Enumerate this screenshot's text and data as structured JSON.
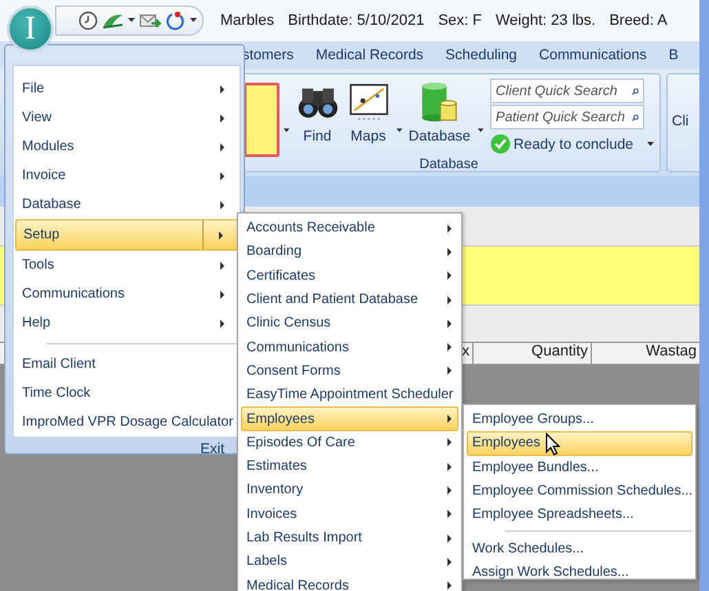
{
  "app_button": {
    "label": "I"
  },
  "patient_info": [
    "Marbles",
    "Birthdate: 5/10/2021",
    "Sex: F",
    "Weight: 23 lbs.",
    "Breed: A"
  ],
  "ribbon_tabs": [
    {
      "label": "stomers",
      "selected": false
    },
    {
      "label": "Medical Records",
      "selected": false
    },
    {
      "label": "Scheduling",
      "selected": false
    },
    {
      "label": "Communications",
      "selected": false
    },
    {
      "label": "B",
      "selected": false
    }
  ],
  "ribbon": {
    "buttons": [
      {
        "label": "Find",
        "kind": "binoculars"
      },
      {
        "label": "Maps",
        "kind": "chart"
      },
      {
        "label": "Database",
        "kind": "database"
      }
    ],
    "search_fields": [
      {
        "placeholder": "Client Quick Search"
      },
      {
        "placeholder": "Patient Quick Search"
      }
    ],
    "status": "Ready to conclude",
    "group_label": "Database",
    "next_group": "Cli"
  },
  "grid": {
    "columns": [
      "x",
      "Quantity",
      "Wastag"
    ]
  },
  "app_menu": {
    "items": [
      {
        "label": "File",
        "has_submenu": true,
        "selected": false
      },
      {
        "label": "View",
        "has_submenu": true,
        "selected": false
      },
      {
        "label": "Modules",
        "has_submenu": true,
        "selected": false
      },
      {
        "label": "Invoice",
        "has_submenu": true,
        "selected": false
      },
      {
        "label": "Database",
        "has_submenu": true,
        "selected": false
      },
      {
        "label": "Setup",
        "has_submenu": true,
        "selected": true
      },
      {
        "label": "Tools",
        "has_submenu": true,
        "selected": false
      },
      {
        "label": "Communications",
        "has_submenu": true,
        "selected": false
      },
      {
        "label": "Help",
        "has_submenu": true,
        "selected": false
      },
      {
        "label": "Email Client",
        "has_submenu": false,
        "selected": false,
        "separator_before": true
      },
      {
        "label": "Time Clock",
        "has_submenu": false,
        "selected": false
      },
      {
        "label": "ImproMed VPR Dosage Calculator",
        "has_submenu": false,
        "selected": false
      }
    ],
    "exit": "Exit"
  },
  "setup_menu": [
    {
      "label": "Accounts Receivable",
      "selected": false
    },
    {
      "label": "Boarding",
      "selected": false
    },
    {
      "label": "Certificates",
      "selected": false
    },
    {
      "label": "Client and Patient Database",
      "selected": false
    },
    {
      "label": "Clinic Census",
      "selected": false
    },
    {
      "label": "Communications",
      "selected": false
    },
    {
      "label": "Consent Forms",
      "selected": false
    },
    {
      "label": "EasyTime Appointment Scheduler",
      "selected": false
    },
    {
      "label": "Employees",
      "selected": true
    },
    {
      "label": "Episodes Of Care",
      "selected": false
    },
    {
      "label": "Estimates",
      "selected": false
    },
    {
      "label": "Inventory",
      "selected": false
    },
    {
      "label": "Invoices",
      "selected": false
    },
    {
      "label": "Lab Results Import",
      "selected": false
    },
    {
      "label": "Labels",
      "selected": false
    },
    {
      "label": "Medical Records",
      "selected": false
    }
  ],
  "employees_menu": [
    {
      "label": "Employee Groups...",
      "selected": false
    },
    {
      "label": "Employees",
      "selected": true
    },
    {
      "label": "Employee Bundles...",
      "selected": false
    },
    {
      "label": "Employee Commission Schedules...",
      "selected": false
    },
    {
      "label": "Employee Spreadsheets...",
      "selected": false
    },
    {
      "label": "Work Schedules...",
      "selected": false,
      "separator_before": true
    },
    {
      "label": "Assign Work Schedules...",
      "selected": false
    }
  ]
}
